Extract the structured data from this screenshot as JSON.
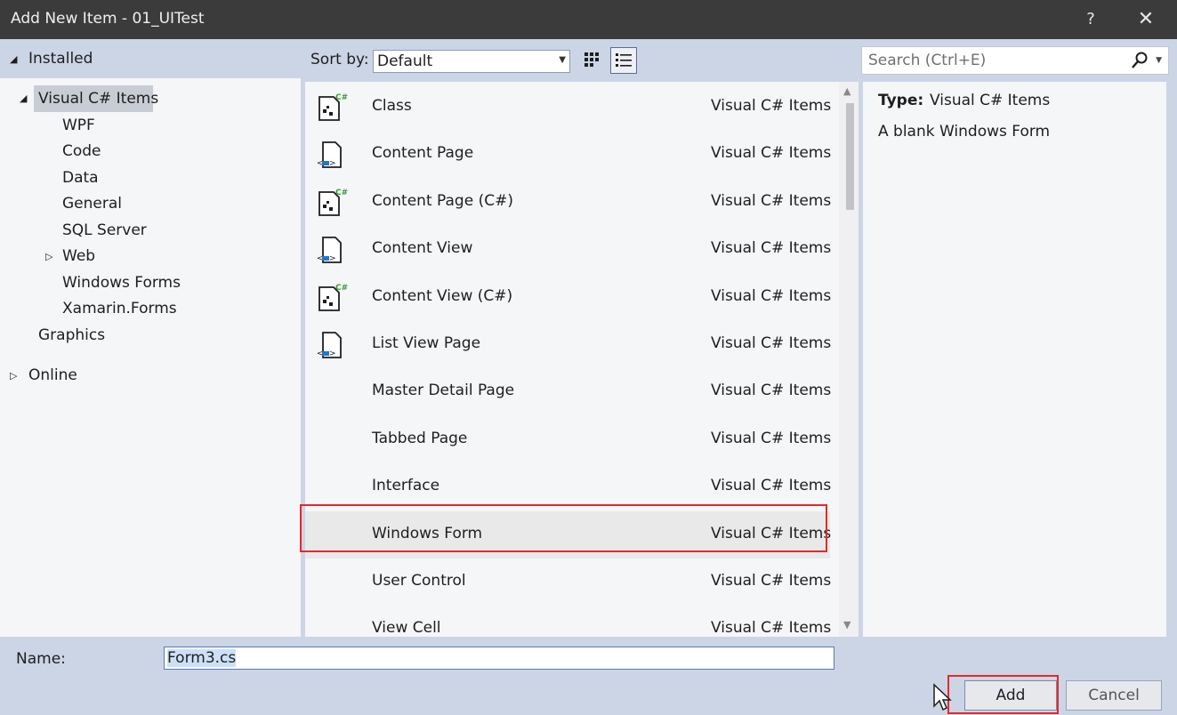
{
  "window": {
    "title": "Add New Item - 01_UITest",
    "help_label": "?",
    "close_label": "✕"
  },
  "tree": {
    "installed": "Installed",
    "visual_csharp": "Visual C# Items",
    "children": [
      "WPF",
      "Code",
      "Data",
      "General",
      "SQL Server",
      "Web",
      "Windows Forms",
      "Xamarin.Forms"
    ],
    "graphics": "Graphics",
    "online": "Online"
  },
  "toolbar": {
    "sort_label": "Sort by:",
    "sort_value": "Default",
    "search_placeholder": "Search (Ctrl+E)"
  },
  "templates": [
    {
      "name": "Class",
      "category": "Visual C# Items",
      "icon": "csharp-class-icon"
    },
    {
      "name": "Content Page",
      "category": "Visual C# Items",
      "icon": "xaml-page-icon"
    },
    {
      "name": "Content Page (C#)",
      "category": "Visual C# Items",
      "icon": "csharp-class-icon"
    },
    {
      "name": "Content View",
      "category": "Visual C# Items",
      "icon": "xaml-page-icon"
    },
    {
      "name": "Content View (C#)",
      "category": "Visual C# Items",
      "icon": "csharp-class-icon"
    },
    {
      "name": "List View Page",
      "category": "Visual C# Items",
      "icon": "xaml-page-icon"
    },
    {
      "name": "Master Detail Page",
      "category": "Visual C# Items",
      "icon": ""
    },
    {
      "name": "Tabbed Page",
      "category": "Visual C# Items",
      "icon": ""
    },
    {
      "name": "Interface",
      "category": "Visual C# Items",
      "icon": ""
    },
    {
      "name": "Windows Form",
      "category": "Visual C# Items",
      "icon": ""
    },
    {
      "name": "User Control",
      "category": "Visual C# Items",
      "icon": ""
    },
    {
      "name": "View Cell",
      "category": "Visual C# Items",
      "icon": ""
    }
  ],
  "selected_template": "Windows Form",
  "details": {
    "type_label": "Type:",
    "type_value": "Visual C# Items",
    "description": "A blank Windows Form"
  },
  "name_field": {
    "label": "Name:",
    "value": "Form3.cs"
  },
  "buttons": {
    "add": "Add",
    "cancel": "Cancel"
  },
  "colors": {
    "title_bar": "#3b3b3b",
    "chrome": "#ccd5e6",
    "panel": "#f5f6f8",
    "highlight_outline": "#e02b2b"
  }
}
